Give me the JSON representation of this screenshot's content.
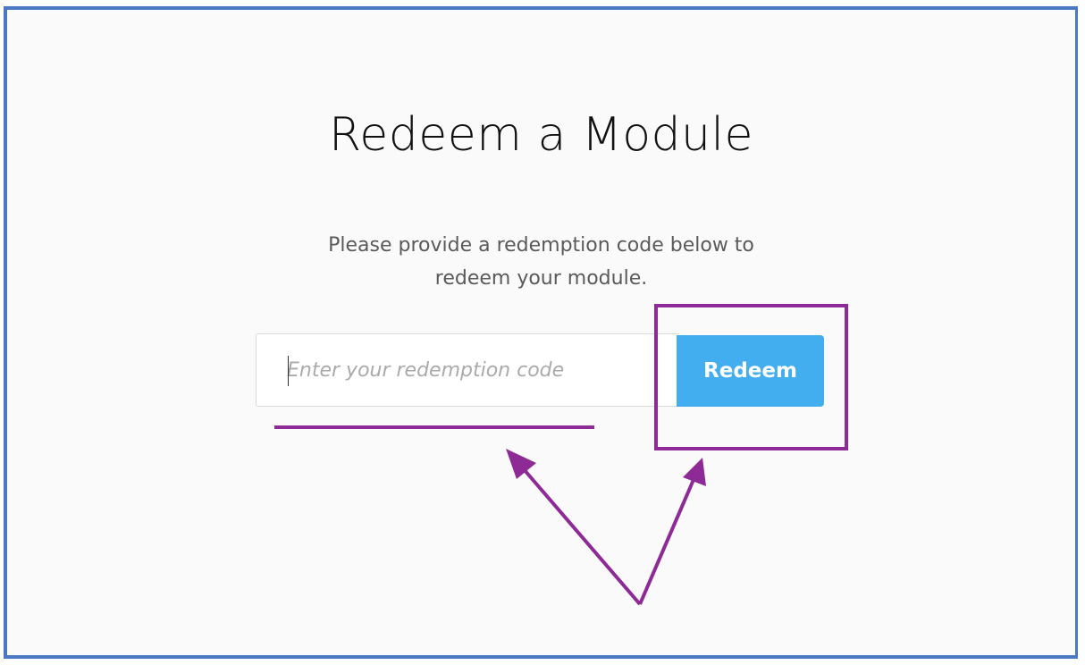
{
  "page": {
    "title": "Redeem a Module",
    "description_line1": "Please provide a redemption code below to",
    "description_line2": "redeem your module."
  },
  "redeem_form": {
    "code_input": {
      "value": "",
      "placeholder": "Enter your redemption code"
    },
    "redeem_label": "Redeem"
  },
  "colors": {
    "frame_border": "#4a78c4",
    "background": "#fafafa",
    "button": "#42adef",
    "annotation": "#8e2a96"
  }
}
